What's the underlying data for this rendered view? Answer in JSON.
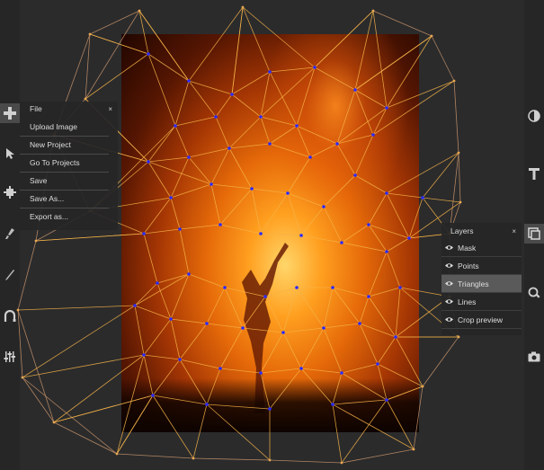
{
  "left_tools": [
    {
      "name": "add-icon"
    },
    {
      "name": "pointer-icon"
    },
    {
      "name": "point-tool-icon"
    },
    {
      "name": "brush-icon"
    },
    {
      "name": "pen-icon"
    },
    {
      "name": "curve-icon"
    },
    {
      "name": "sliders-icon"
    }
  ],
  "right_tools": [
    {
      "name": "contrast-icon"
    },
    {
      "name": "text-icon"
    },
    {
      "name": "layers-icon"
    },
    {
      "name": "zoom-icon"
    },
    {
      "name": "camera-icon"
    }
  ],
  "file_panel": {
    "title": "File",
    "close": "×",
    "items": [
      "Upload Image",
      "New Project",
      "Go To Projects",
      "Save",
      "Save As...",
      "Export as..."
    ]
  },
  "layers_panel": {
    "title": "Layers",
    "close": "×",
    "layers": [
      {
        "label": "Mask",
        "active": false
      },
      {
        "label": "Points",
        "active": false
      },
      {
        "label": "Triangles",
        "active": true
      },
      {
        "label": "Lines",
        "active": false
      },
      {
        "label": "Crop preview",
        "active": false
      }
    ]
  },
  "colors": {
    "background": "#2b2b2c",
    "toolbar": "#262627",
    "mesh_lines": "#f5b347",
    "mesh_points": "#2a2aff",
    "panel": "#262627",
    "active_row": "#5a5a5b"
  }
}
